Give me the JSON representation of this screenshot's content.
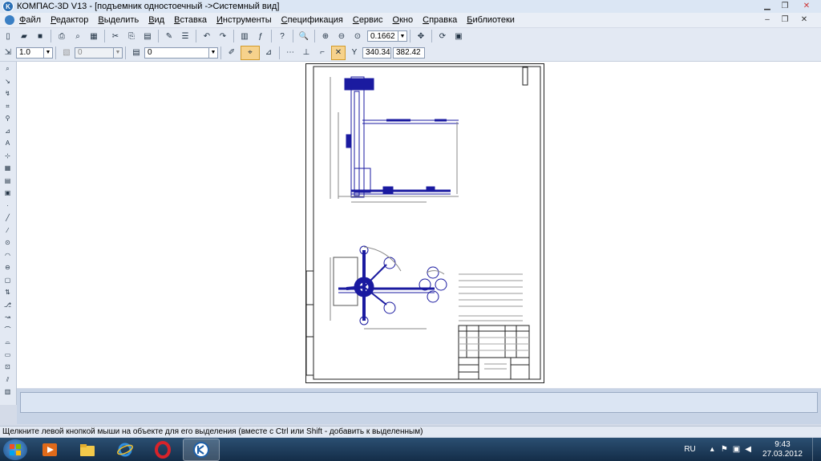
{
  "window": {
    "title": "КОМПАС-3D V13 - [подъемник одностоечный ->Системный вид]"
  },
  "menu": [
    {
      "underline": "Ф",
      "rest": "айл"
    },
    {
      "underline": "Р",
      "rest": "едактор"
    },
    {
      "underline": "В",
      "rest": "ыделить"
    },
    {
      "underline": "В",
      "rest": "ид"
    },
    {
      "underline": "В",
      "rest": "ставка"
    },
    {
      "underline": "И",
      "rest": "нструменты"
    },
    {
      "underline": "С",
      "rest": "пецификация"
    },
    {
      "underline": "С",
      "rest": "ервис"
    },
    {
      "underline": "О",
      "rest": "кно"
    },
    {
      "underline": "С",
      "rest": "правка"
    },
    {
      "underline": "Б",
      "rest": "иблиотеки"
    }
  ],
  "toolbar1": {
    "zoom_value": "0.1662"
  },
  "toolbar2": {
    "scale_value": "1.0",
    "layer_value": "0",
    "style_value": "0",
    "coord_x": "340.34",
    "coord_y": "382.42"
  },
  "status": {
    "hint": "Щелкните левой кнопкой мыши на объекте для его выделения (вместе с Ctrl или Shift - добавить к выделенным)"
  },
  "taskbar": {
    "language": "RU",
    "time": "9:43",
    "date": "27.03.2012"
  },
  "colors": {
    "drawing": "#1a1aa0",
    "frame": "#222222",
    "taskbar": "#1f3d5e"
  }
}
